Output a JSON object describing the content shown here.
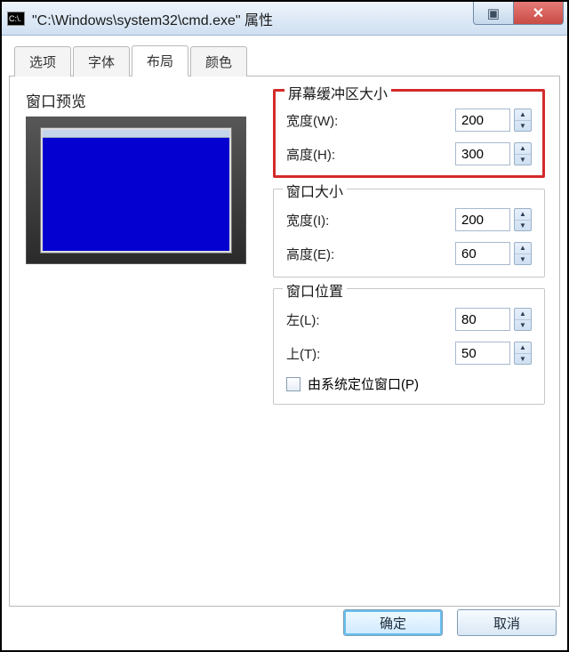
{
  "titlebar": {
    "icon_text": "C:\\.",
    "title": "\"C:\\Windows\\system32\\cmd.exe\" 属性"
  },
  "tabs": {
    "options": "选项",
    "font": "字体",
    "layout": "布局",
    "colors": "颜色"
  },
  "preview_label": "窗口预览",
  "groups": {
    "buffer": {
      "title": "屏幕缓冲区大小",
      "width_label": "宽度(W):",
      "height_label": "高度(H):",
      "width_value": "200",
      "height_value": "300"
    },
    "winsize": {
      "title": "窗口大小",
      "width_label": "宽度(I):",
      "height_label": "高度(E):",
      "width_value": "200",
      "height_value": "60"
    },
    "winpos": {
      "title": "窗口位置",
      "left_label": "左(L):",
      "top_label": "上(T):",
      "left_value": "80",
      "top_value": "50",
      "system_pos_label": "由系统定位窗口(P)"
    }
  },
  "footer": {
    "ok": "确定",
    "cancel": "取消"
  }
}
